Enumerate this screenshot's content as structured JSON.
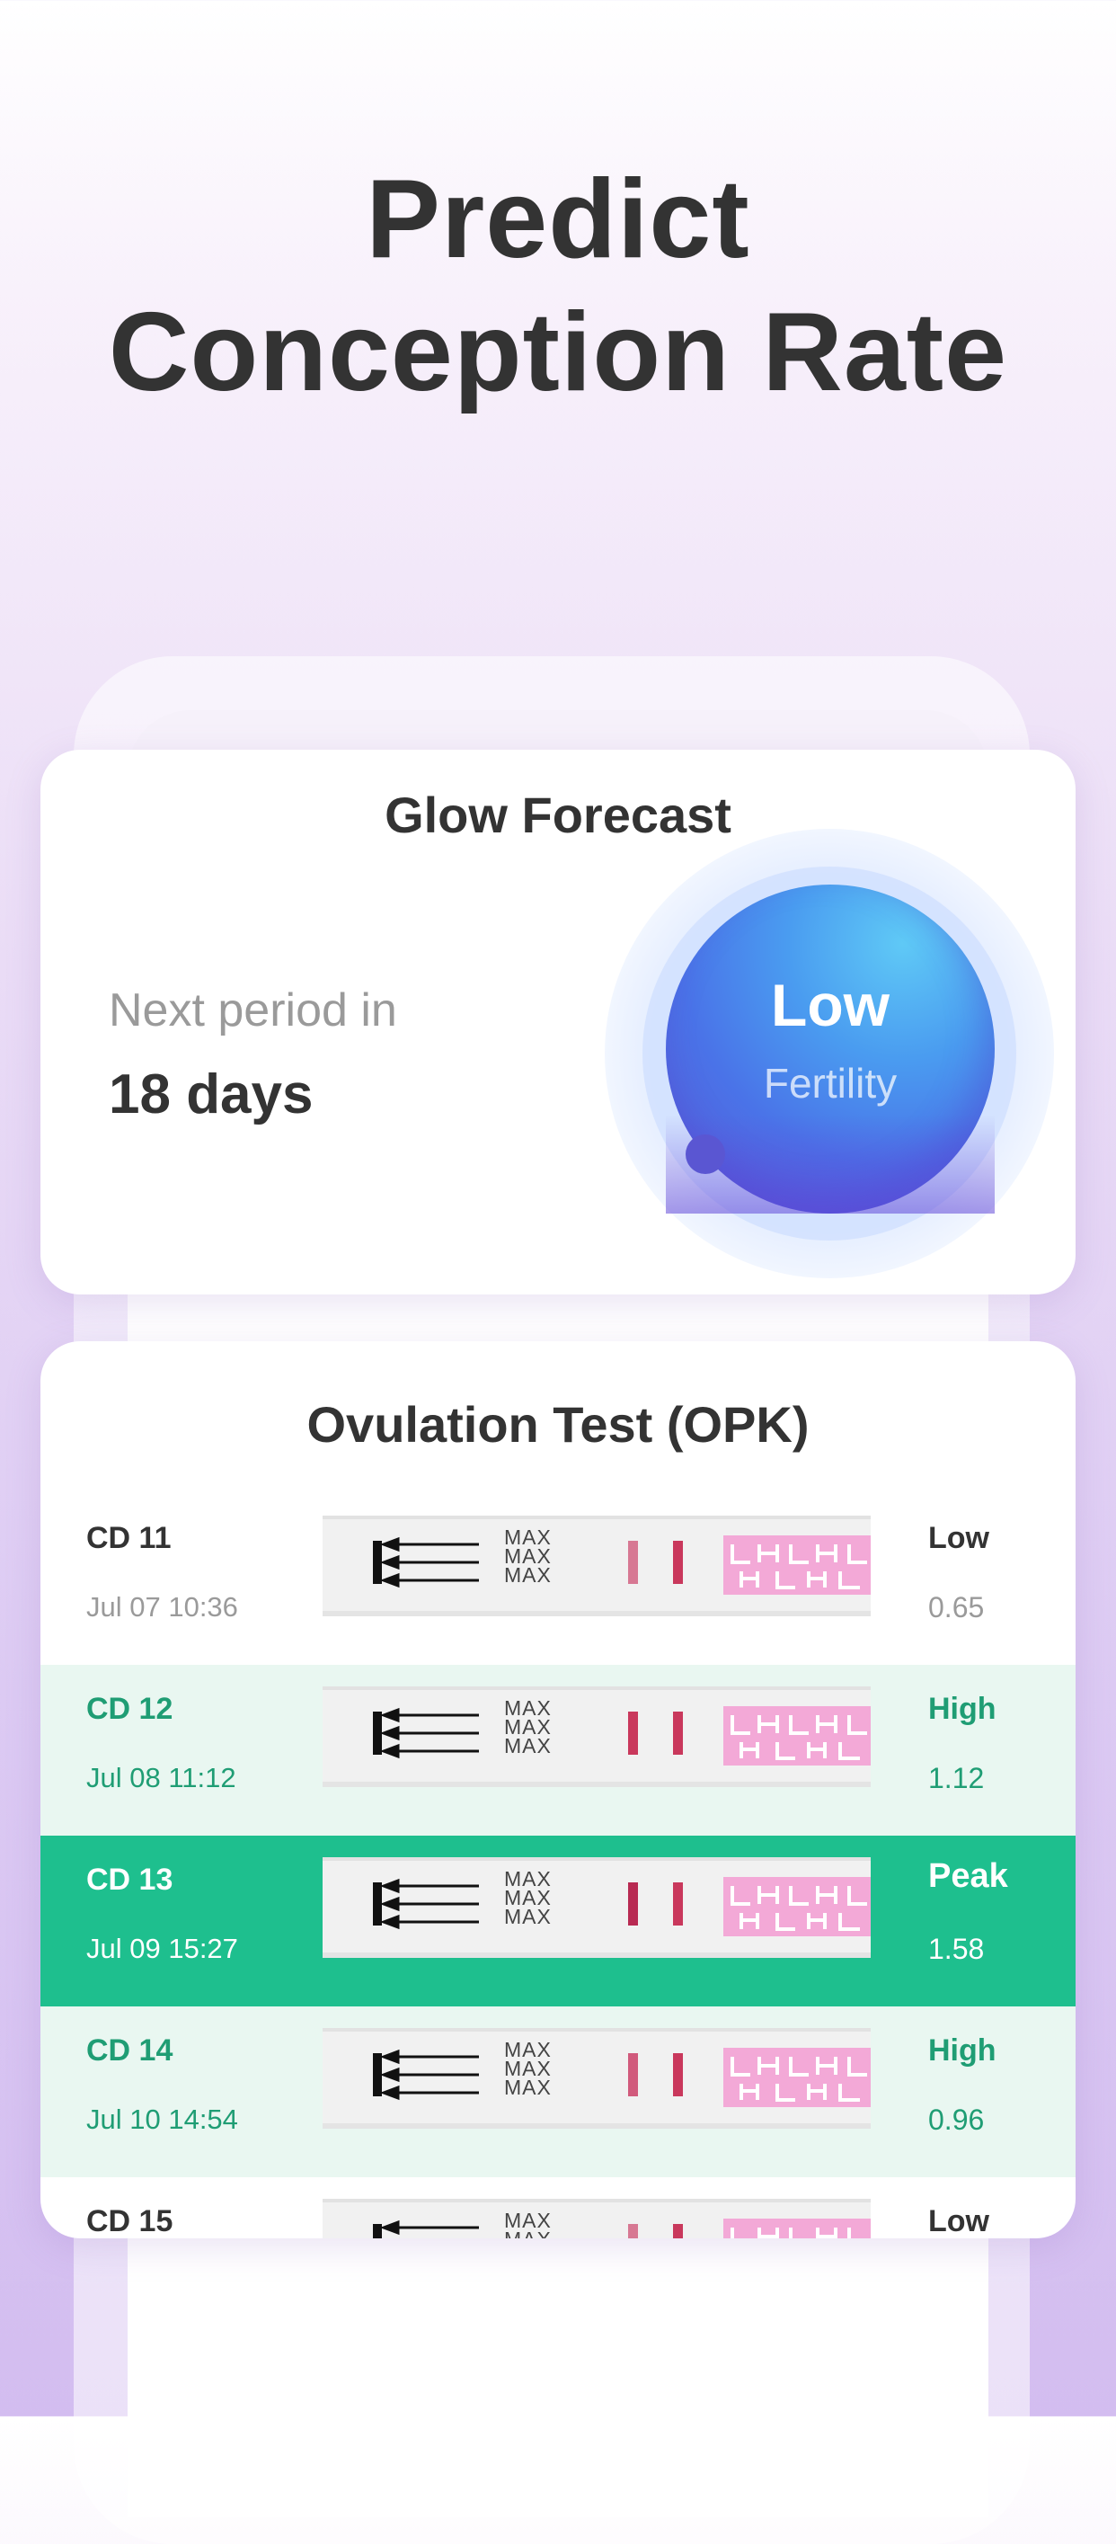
{
  "headline": {
    "line1": "Predict",
    "line2": "Conception Rate"
  },
  "forecast": {
    "title": "Glow Forecast",
    "next_period_label": "Next period in",
    "next_period_value": "18 days",
    "fertility_level": "Low",
    "fertility_label": "Fertility"
  },
  "opk": {
    "title": "Ovulation Test (OPK)",
    "strip_text": [
      "MAX",
      "MAX",
      "MAX"
    ],
    "rows": [
      {
        "cd": "CD 11",
        "date": "Jul 07 10:36",
        "level": "Low",
        "value": "0.65"
      },
      {
        "cd": "CD 12",
        "date": "Jul 08 11:12",
        "level": "High",
        "value": "1.12"
      },
      {
        "cd": "CD 13",
        "date": "Jul 09 15:27",
        "level": "Peak",
        "value": "1.58"
      },
      {
        "cd": "CD 14",
        "date": "Jul 10 14:54",
        "level": "High",
        "value": "0.96"
      },
      {
        "cd": "CD 15",
        "date": "",
        "level": "Low",
        "value": ""
      }
    ]
  },
  "colors": {
    "accent_green": "#1ebf8e",
    "light_green": "#e9f7f1",
    "test_line": "#c9385c",
    "orb_blue": "#4a73e8"
  }
}
